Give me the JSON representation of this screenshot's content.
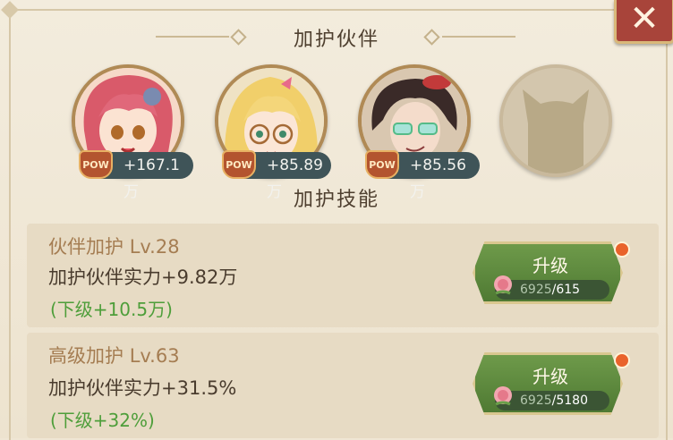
{
  "panel": {
    "companions_title": "加护伙伴",
    "skills_title": "加护技能"
  },
  "companions": [
    {
      "name": "pink-hair-girl",
      "pow_label": "POW",
      "bonus": "+167.1万"
    },
    {
      "name": "blonde-elf-girl",
      "pow_label": "POW",
      "bonus": "+85.89万"
    },
    {
      "name": "dark-hair-man",
      "pow_label": "POW",
      "bonus": "+85.56万"
    },
    {
      "name": "empty-slot"
    }
  ],
  "skills": [
    {
      "name": "伙伴加护",
      "level": "Lv.28",
      "effect": "加护伙伴实力+9.82万",
      "next": "(下级+10.5万)",
      "button_label": "升级",
      "cost_have": "6925",
      "cost_need": "/615"
    },
    {
      "name": "高级加护",
      "level": "Lv.63",
      "effect": "加护伙伴实力+31.5%",
      "next": "(下级+32%)",
      "button_label": "升级",
      "cost_have": "6925",
      "cost_need": "/5180"
    }
  ],
  "icons": {
    "close": "close-icon",
    "pow": "pow-icon",
    "cost": "rose-icon"
  },
  "colors": {
    "accent_green": "#4e7a33",
    "skill_name": "#a57d52",
    "next_level": "#4e9e3a",
    "close_red": "#a8443a"
  }
}
